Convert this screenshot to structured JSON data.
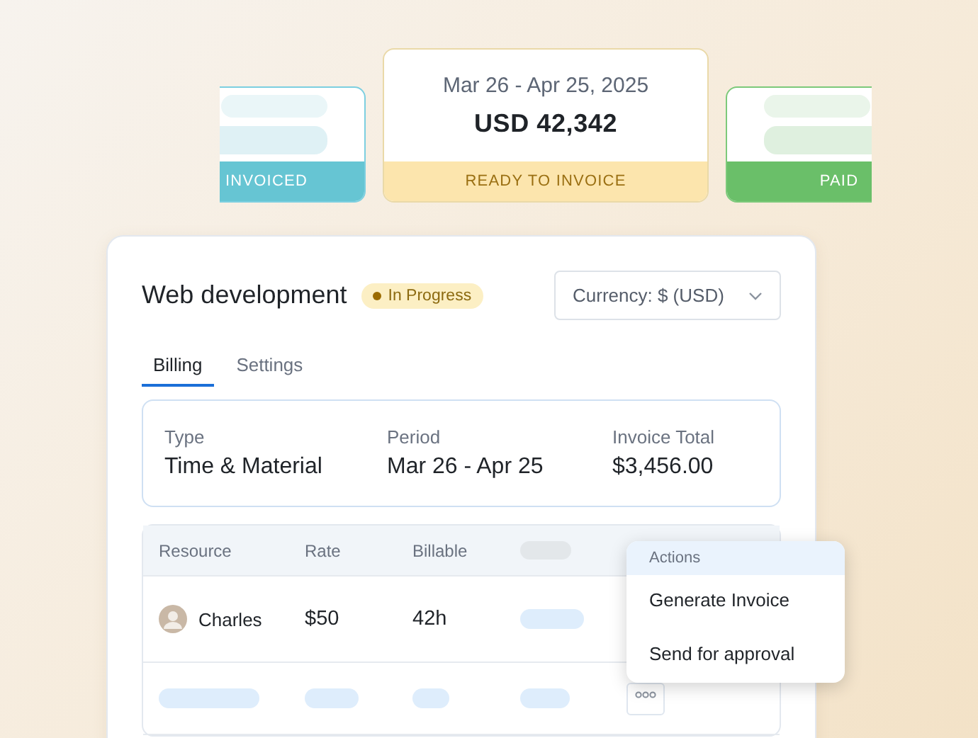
{
  "status_cards": [
    {
      "kind": "invoiced",
      "label": "INVOICED"
    },
    {
      "kind": "ready",
      "label": "READY TO INVOICE",
      "period": "Mar 26 - Apr 25, 2025",
      "amount": "USD 42,342"
    },
    {
      "kind": "paid",
      "label": "PAID"
    }
  ],
  "project": {
    "title": "Web development",
    "badge": "In Progress",
    "currency": "Currency: $ (USD)"
  },
  "tabs": [
    {
      "label": "Billing",
      "selected": true
    },
    {
      "label": "Settings",
      "selected": false
    }
  ],
  "summary": [
    {
      "label": "Type",
      "value": "Time & Material"
    },
    {
      "label": "Period",
      "value": "Mar 26 - Apr 25"
    },
    {
      "label": "Invoice Total",
      "value": "$3,456.00"
    }
  ],
  "table": {
    "columns": [
      "Resource",
      "Rate",
      "Billable"
    ],
    "rows": [
      {
        "kind": "entry",
        "resource": "Charles",
        "rate": "$50",
        "billable": "42h"
      },
      {
        "kind": "placeholder"
      }
    ]
  },
  "actions_menu": {
    "header": "Actions",
    "items": [
      "Generate Invoice",
      "Send for approval"
    ]
  }
}
